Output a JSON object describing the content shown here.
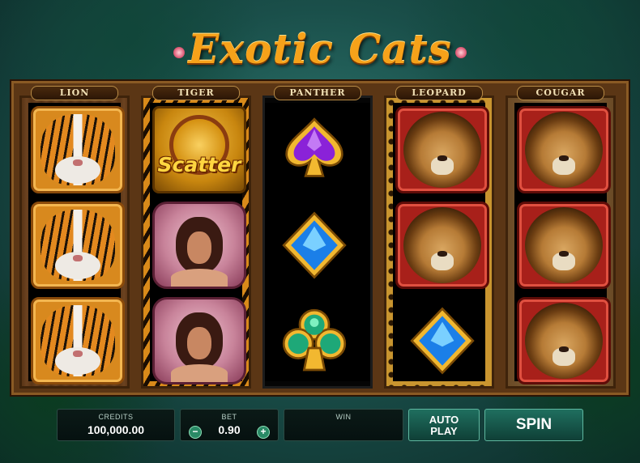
{
  "game": {
    "title": "Exotic Cats"
  },
  "reels": [
    {
      "label": "LION",
      "symbols": [
        "tiger",
        "tiger",
        "tiger"
      ]
    },
    {
      "label": "TIGER",
      "symbols": [
        "scatter",
        "woman",
        "woman"
      ]
    },
    {
      "label": "PANTHER",
      "symbols": [
        "spade-purple",
        "diamond-blue",
        "club-green"
      ]
    },
    {
      "label": "LEOPARD",
      "symbols": [
        "lion",
        "lion",
        "diamond-blue"
      ]
    },
    {
      "label": "COUGAR",
      "symbols": [
        "lion",
        "lion",
        "lion"
      ]
    }
  ],
  "scatter_label": "Scatter",
  "controls": {
    "credits_caption": "CREDITS",
    "credits_value": "100,000.00",
    "bet_caption": "BET",
    "bet_value": "0.90",
    "bet_minus": "−",
    "bet_plus": "+",
    "win_caption": "WIN",
    "win_value": "",
    "autoplay_label_line1": "AUTO",
    "autoplay_label_line2": "PLAY",
    "spin_label": "SPIN"
  },
  "colors": {
    "gold": "#f6a21a",
    "panel_bg": "#061110",
    "button": "#1f6f5f"
  }
}
